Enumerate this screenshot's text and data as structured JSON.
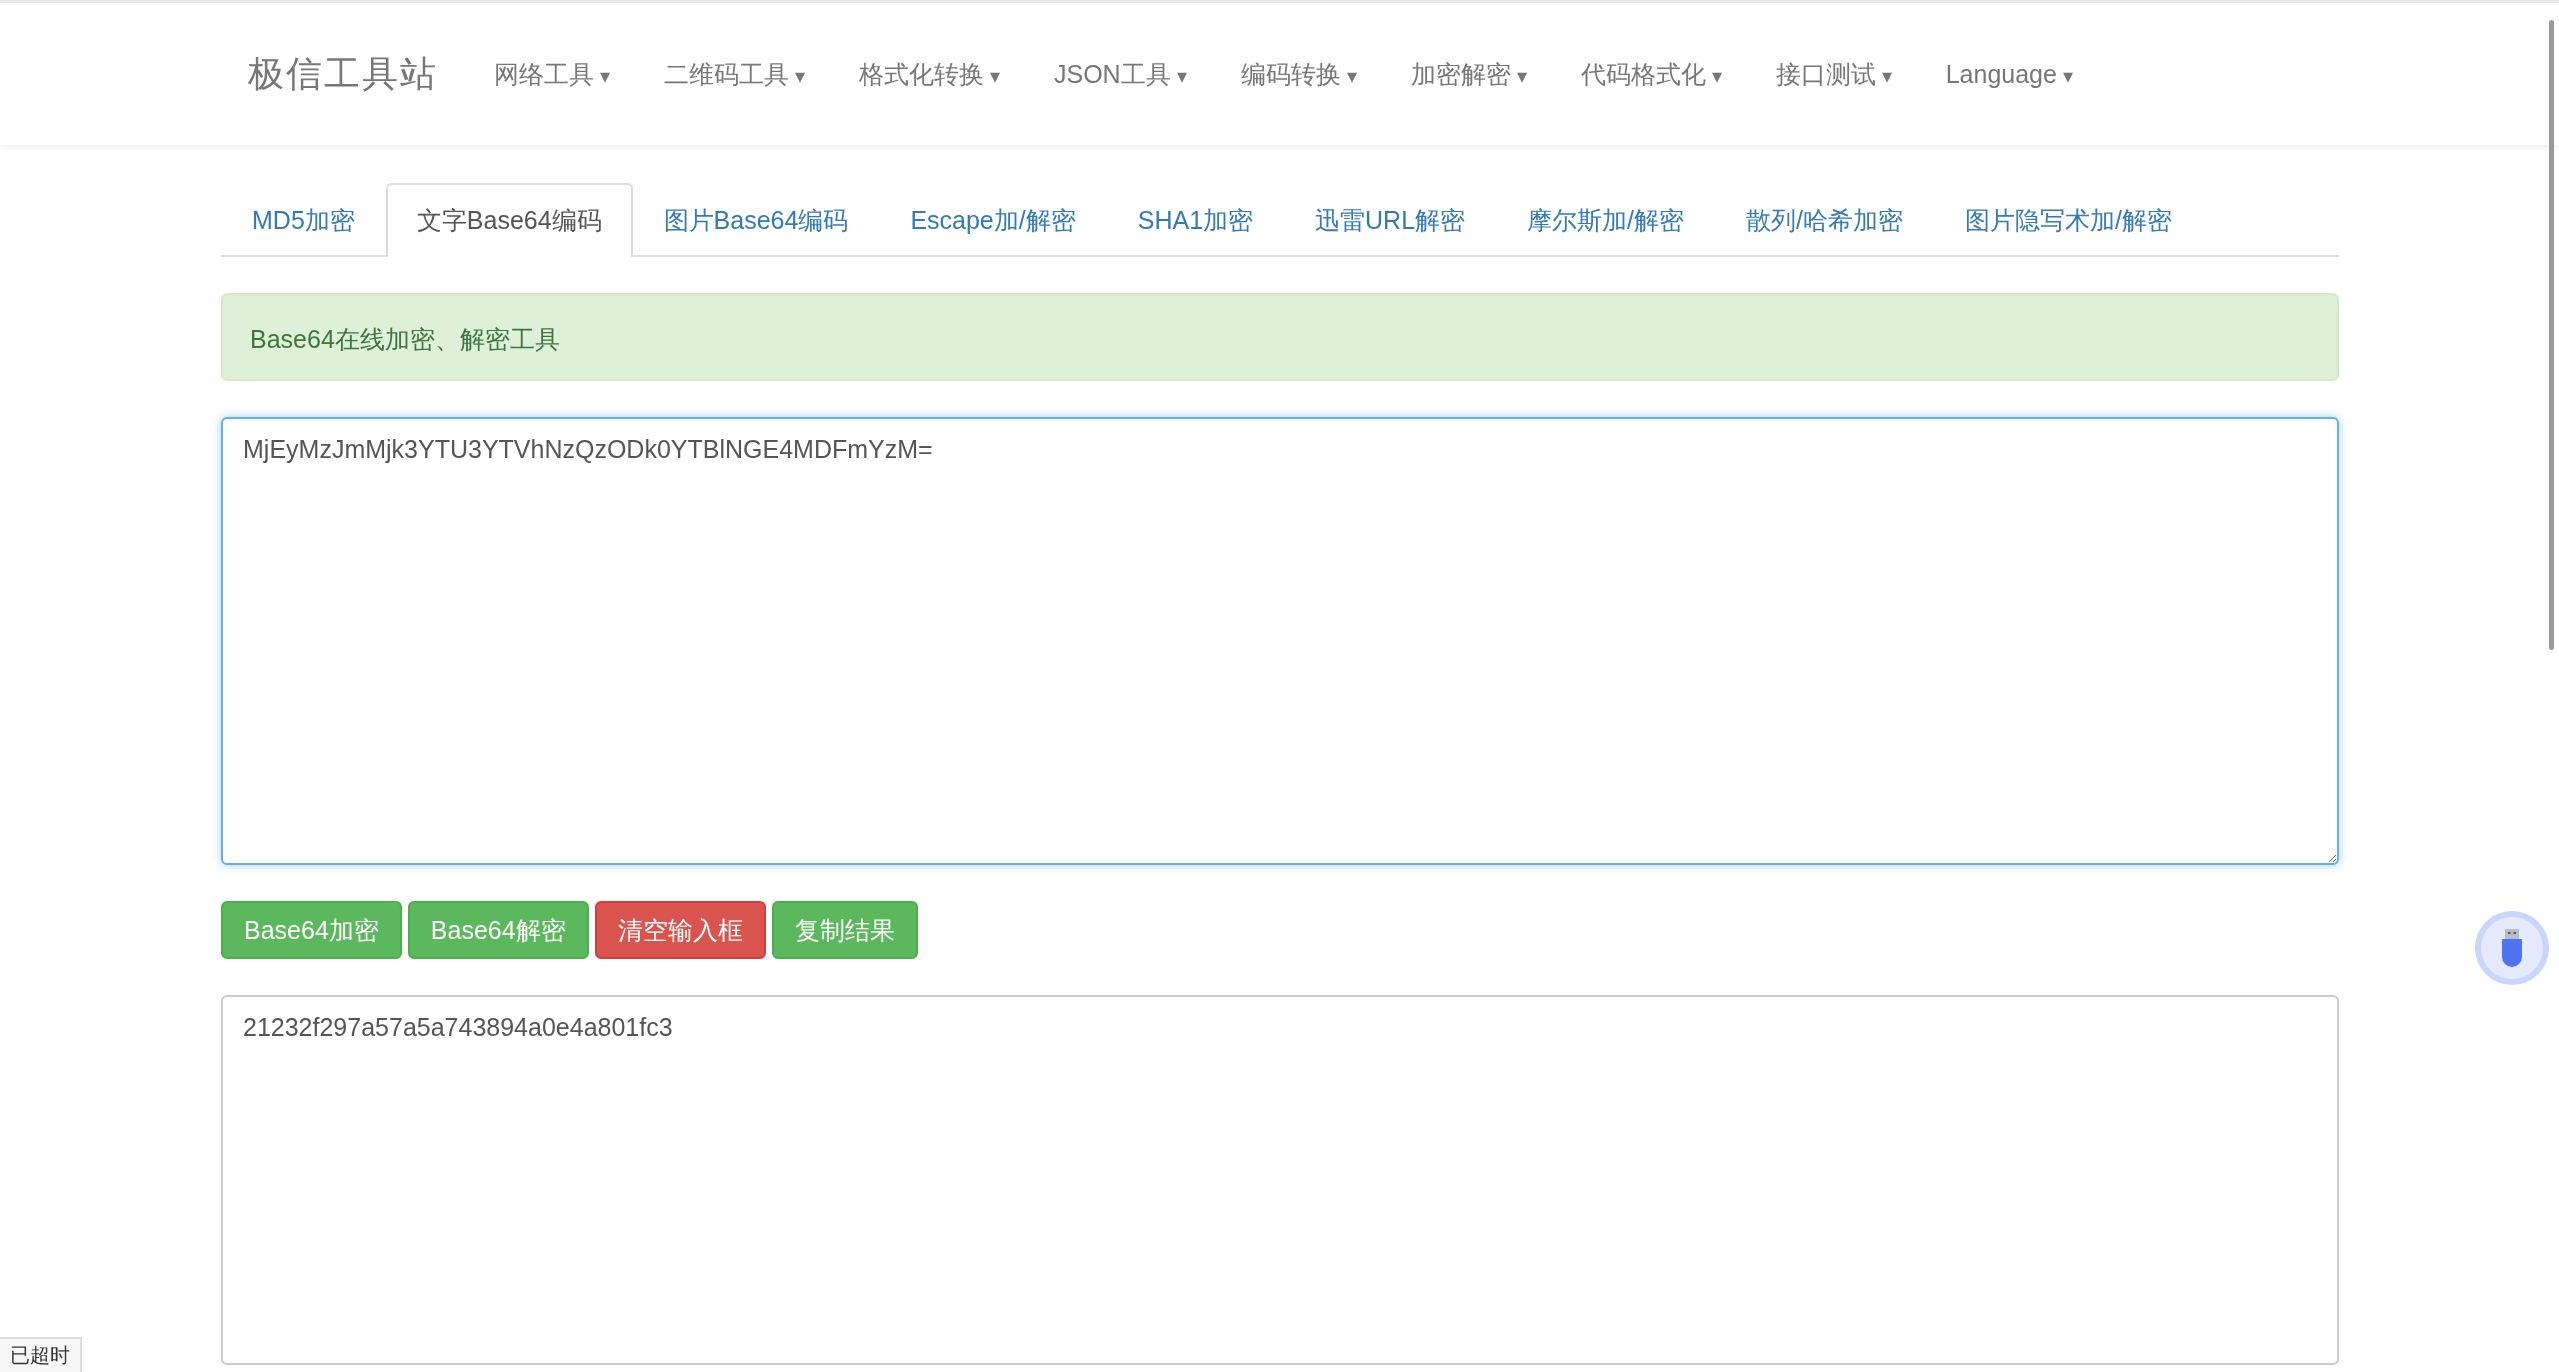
{
  "navbar": {
    "brand": "极信工具站",
    "menus": [
      {
        "label": "网络工具",
        "caret": "▾"
      },
      {
        "label": "二维码工具",
        "caret": "▾"
      },
      {
        "label": "格式化转换",
        "caret": "▾"
      },
      {
        "label": "JSON工具",
        "caret": "▾"
      },
      {
        "label": "编码转换",
        "caret": "▾"
      },
      {
        "label": "加密解密",
        "caret": "▾"
      },
      {
        "label": "代码格式化",
        "caret": "▾"
      },
      {
        "label": "接口测试",
        "caret": "▾"
      },
      {
        "label": "Language",
        "caret": "▾"
      }
    ]
  },
  "tabs": [
    {
      "label": "MD5加密",
      "selected": false
    },
    {
      "label": "文字Base64编码",
      "selected": true
    },
    {
      "label": "图片Base64编码",
      "selected": false
    },
    {
      "label": "Escape加/解密",
      "selected": false
    },
    {
      "label": "SHA1加密",
      "selected": false
    },
    {
      "label": "迅雷URL解密",
      "selected": false
    },
    {
      "label": "摩尔斯加/解密",
      "selected": false
    },
    {
      "label": "散列/哈希加密",
      "selected": false
    },
    {
      "label": "图片隐写术加/解密",
      "selected": false
    }
  ],
  "alert": {
    "text": "Base64在线加密、解密工具"
  },
  "input": {
    "value": "MjEyMzJmMjk3YTU3YTVhNzQzODk0YTBlNGE4MDFmYzM=",
    "focused": true
  },
  "buttons": [
    {
      "label": "Base64加密",
      "kind": "success"
    },
    {
      "label": "Base64解密",
      "kind": "success"
    },
    {
      "label": "清空输入框",
      "kind": "danger"
    },
    {
      "label": "复制结果",
      "kind": "success"
    }
  ],
  "output": {
    "value": "21232f297a57a5a743894a0e4a801fc3"
  },
  "status_bubble": "已超时"
}
